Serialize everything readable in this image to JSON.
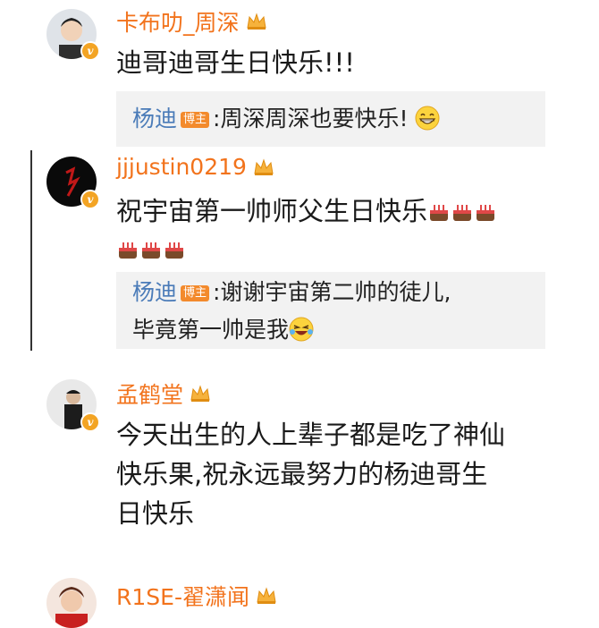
{
  "comments": [
    {
      "username": "卡布叻_周深",
      "text": "迪哥迪哥生日快乐!!!",
      "reply": {
        "author": "杨迪",
        "badge": "博主",
        "text": ":周深周深也要快乐!"
      }
    },
    {
      "username": "jjjustin0219",
      "text_line1": "祝宇宙第一帅师父生日快乐",
      "reply": {
        "author": "杨迪",
        "badge": "博主",
        "text_line1": ":谢谢宇宙第二帅的徒儿,",
        "text_line2": "毕竟第一帅是我"
      }
    },
    {
      "username": "孟鹤堂",
      "text_lines": [
        "今天出生的人上辈子都是吃了神仙",
        "快乐果,祝永远最努力的杨迪哥生",
        "日快乐"
      ]
    },
    {
      "username": "R1SE-翟潇闻"
    }
  ],
  "icons": {
    "verified": "v-badge-icon",
    "crown": "crown-icon",
    "cake": "birthday-cake-icon",
    "grin": "grin-emoji",
    "laugh": "laugh-tears-emoji"
  },
  "colors": {
    "username": "#f2731c",
    "reply_author": "#4a7bb8",
    "badge": "#f38a2c",
    "reply_bg": "#f2f2f2"
  }
}
